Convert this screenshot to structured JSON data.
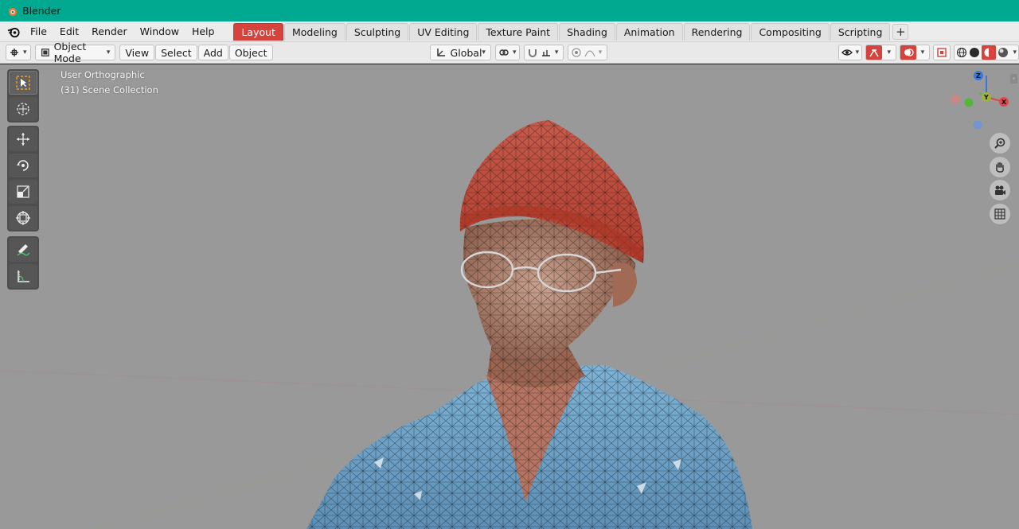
{
  "app": {
    "title": "Blender"
  },
  "menu": [
    "File",
    "Edit",
    "Render",
    "Window",
    "Help"
  ],
  "workspaces": {
    "active": "Layout",
    "tabs": [
      "Layout",
      "Modeling",
      "Sculpting",
      "UV Editing",
      "Texture Paint",
      "Shading",
      "Animation",
      "Rendering",
      "Compositing",
      "Scripting"
    ],
    "add_symbol": "+"
  },
  "header": {
    "mode": "Object Mode",
    "view": "View",
    "select": "Select",
    "add": "Add",
    "object": "Object",
    "transform_orientation": "Global"
  },
  "viewport": {
    "view_label": "User Orthographic",
    "collection_label": "(31) Scene Collection",
    "background": "#999999"
  },
  "gizmo": {
    "x": "X",
    "y": "Y",
    "z": "Z"
  },
  "icons": {
    "left_tools": [
      "select-box-icon",
      "cursor-icon",
      "move-icon",
      "rotate-icon",
      "scale-icon",
      "transform-icon",
      "annotate-icon",
      "measure-icon"
    ],
    "nav": [
      "zoom-icon",
      "hand-pan-icon",
      "camera-icon",
      "grid-icon"
    ]
  },
  "colors": {
    "titlebar": "#00a98f",
    "active_tab": "#d6423c",
    "hat": "#c9523f",
    "shirt": "#6fa3c8",
    "skin": "#b87a62"
  }
}
